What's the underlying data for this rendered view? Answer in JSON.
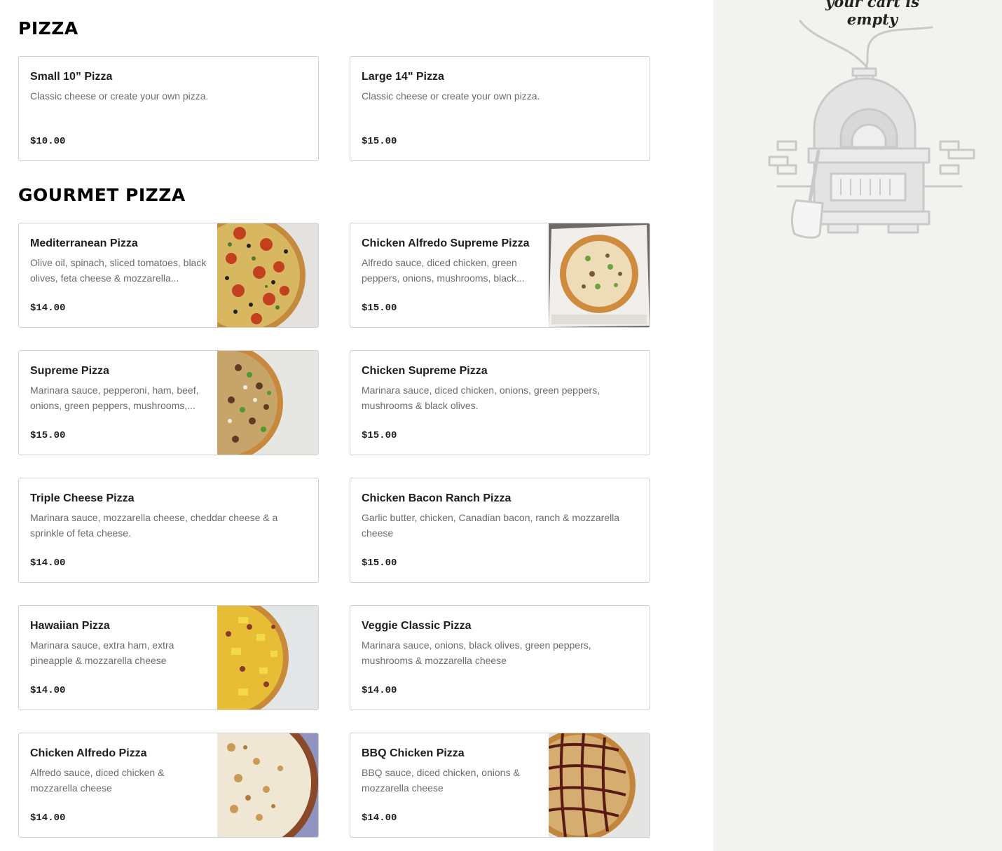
{
  "sections": [
    {
      "title": "PIZZA",
      "items": [
        {
          "name": "Small 10” Pizza",
          "description": "Classic cheese or create your own pizza.",
          "price": "$10.00"
        },
        {
          "name": "Large 14\" Pizza",
          "description": "Classic cheese or create your own pizza.",
          "price": "$15.00"
        }
      ]
    },
    {
      "title": "GOURMET PIZZA",
      "items": [
        {
          "name": "Mediterranean Pizza",
          "description": "Olive oil, spinach, sliced tomatoes, black olives, feta cheese & mozzarella...",
          "price": "$14.00",
          "image": "mediterranean-pizza-photo"
        },
        {
          "name": "Chicken Alfredo Supreme Pizza",
          "description": "Alfredo sauce, diced chicken, green peppers, onions, mushrooms, black...",
          "price": "$15.00",
          "image": "chicken-alfredo-supreme-pizza-photo"
        },
        {
          "name": "Supreme Pizza",
          "description": "Marinara sauce, pepperoni, ham, beef, onions, green peppers, mushrooms,...",
          "price": "$15.00",
          "image": "supreme-pizza-photo"
        },
        {
          "name": "Chicken Supreme Pizza",
          "description": "Marinara sauce, diced chicken, onions, green peppers, mushrooms & black olives.",
          "price": "$15.00"
        },
        {
          "name": "Triple Cheese Pizza",
          "description": "Marinara sauce, mozzarella cheese, cheddar cheese & a sprinkle of feta cheese.",
          "price": "$14.00"
        },
        {
          "name": "Chicken Bacon Ranch Pizza",
          "description": "Garlic butter, chicken, Canadian bacon, ranch & mozzarella cheese",
          "price": "$15.00"
        },
        {
          "name": "Hawaiian Pizza",
          "description": "Marinara sauce, extra ham, extra pineapple & mozzarella cheese",
          "price": "$14.00",
          "image": "hawaiian-pizza-photo"
        },
        {
          "name": "Veggie Classic Pizza",
          "description": "Marinara sauce, onions, black olives, green peppers, mushrooms & mozzarella cheese",
          "price": "$14.00"
        },
        {
          "name": "Chicken Alfredo Pizza",
          "description": "Alfredo sauce, diced chicken & mozzarella cheese",
          "price": "$14.00",
          "image": "chicken-alfredo-pizza-photo"
        },
        {
          "name": "BBQ Chicken Pizza",
          "description": "BBQ sauce, diced chicken, onions & mozzarella cheese",
          "price": "$14.00",
          "image": "bbq-chicken-pizza-photo"
        }
      ]
    }
  ],
  "cart": {
    "empty_message": "your cart is empty",
    "illustration": "pizza-oven-icon"
  },
  "colors": {
    "cart_panel_bg": "#f2f2ef",
    "card_border": "#cfcfcf",
    "description_text": "#6b6b6b"
  }
}
